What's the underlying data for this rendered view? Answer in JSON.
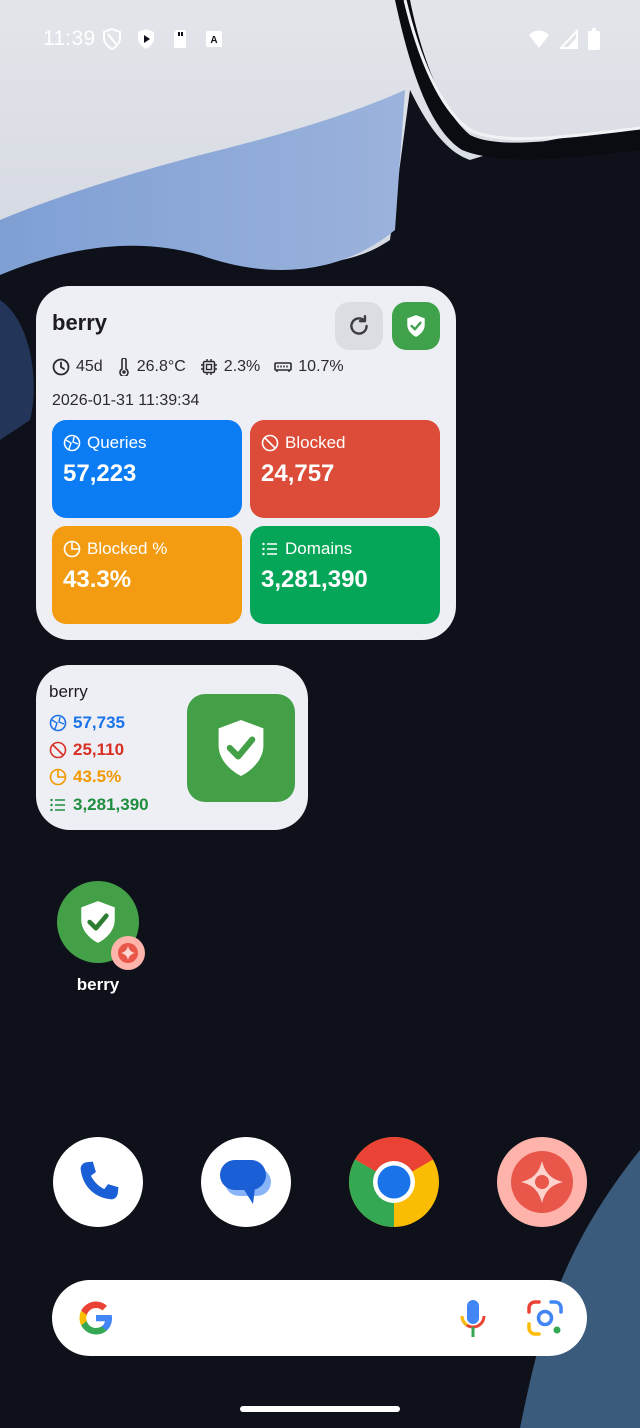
{
  "status_bar": {
    "time": "11:39",
    "left_icons": [
      "vpn-shield-icon",
      "play-protect-icon",
      "sd-card-icon",
      "accessibility-icon"
    ],
    "right_icons": [
      "wifi-icon",
      "cellular-signal-icon",
      "battery-icon"
    ]
  },
  "widget_large": {
    "title": "berry",
    "uptime": "45d",
    "temperature": "26.8°C",
    "cpu": "2.3%",
    "memory": "10.7%",
    "datetime": "2026-01-31 11:39:34",
    "tiles": {
      "queries": {
        "label": "Queries",
        "value": "57,223",
        "color": "#0b7cf3"
      },
      "blocked": {
        "label": "Blocked",
        "value": "24,757",
        "color": "#dc4c38"
      },
      "blocked_pct": {
        "label": "Blocked %",
        "value": "43.3%",
        "color": "#f39c12"
      },
      "domains": {
        "label": "Domains",
        "value": "3,281,390",
        "color": "#05a658"
      }
    }
  },
  "widget_small": {
    "title": "berry",
    "queries": "57,735",
    "blocked": "25,110",
    "blocked_pct": "43.5%",
    "domains": "3,281,390"
  },
  "home_app": {
    "label": "berry"
  },
  "dock": [
    "phone-icon",
    "messages-icon",
    "chrome-icon",
    "berry-app-icon"
  ],
  "search": {
    "icons": [
      "google-g-icon",
      "mic-icon",
      "lens-icon"
    ]
  },
  "colors": {
    "accent_green": "#43a047",
    "widget_bg": "#eeeef5",
    "wallpaper_bg": "#0e1119"
  }
}
